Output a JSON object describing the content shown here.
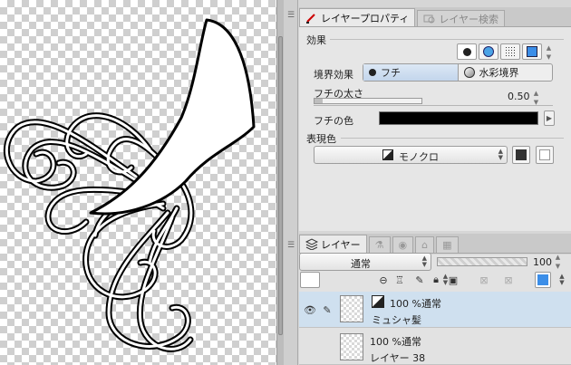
{
  "properties_panel": {
    "tabs": [
      {
        "label": "レイヤープロパティ",
        "active": true
      },
      {
        "label": "レイヤー検索",
        "active": false
      }
    ],
    "effect_section_label": "効果",
    "border_effect_label": "境界効果",
    "border_options": [
      {
        "label": "フチ",
        "selected": true
      },
      {
        "label": "水彩境界",
        "selected": false
      }
    ],
    "edge_width_label": "フチの太さ",
    "edge_width_value": "0.50",
    "edge_width_fraction": 0.08,
    "edge_color_label": "フチの色",
    "edge_color": "#000000",
    "expression_color_label": "表現色",
    "expression_color_value": "モノクロ"
  },
  "layer_panel": {
    "tabs": [
      {
        "label": "レイヤー",
        "active": true
      }
    ],
    "blend_mode": "通常",
    "opacity_value": "100",
    "layers": [
      {
        "opacity_mode": "100 %通常",
        "name": "ミュシャ髪",
        "selected": true,
        "visible": true
      },
      {
        "opacity_mode": "100 %通常",
        "name": "レイヤー 38",
        "selected": false,
        "visible": false
      }
    ]
  },
  "colors": {
    "accent_blue": "#3b8ee8",
    "selected_row": "#cfe0ef"
  }
}
